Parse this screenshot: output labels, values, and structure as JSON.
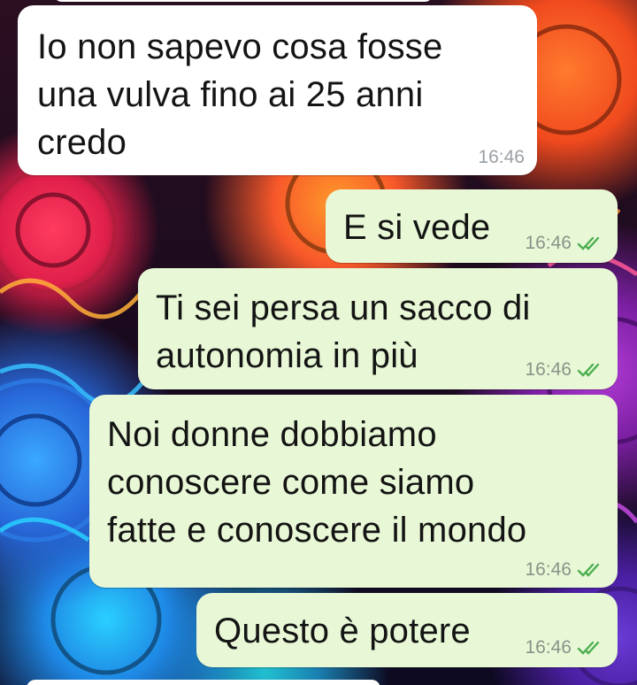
{
  "conversation": {
    "messages": [
      {
        "direction": "incoming",
        "text": "Io non sapevo cosa fosse\nuna vulva fino ai 25 anni\ncredo",
        "time": "16:46"
      },
      {
        "direction": "outgoing",
        "text": "E si vede",
        "time": "16:46",
        "status": "read-ticks-icon"
      },
      {
        "direction": "outgoing",
        "text": "Ti sei persa un sacco di\nautonomia in più",
        "time": "16:46",
        "status": "read-ticks-icon"
      },
      {
        "direction": "outgoing",
        "text": "Noi donne dobbiamo\nconoscere come siamo\nfatte e conoscere il mondo",
        "time": "16:46",
        "status": "read-ticks-icon"
      },
      {
        "direction": "outgoing",
        "text": "Questo è potere",
        "time": "16:46",
        "status": "read-ticks-icon"
      }
    ]
  },
  "colors": {
    "incoming_bubble": "#ffffff",
    "outgoing_bubble": "#e8f8d6",
    "read_ticks": "#4fc3f7",
    "timestamp": "#8a9288"
  }
}
